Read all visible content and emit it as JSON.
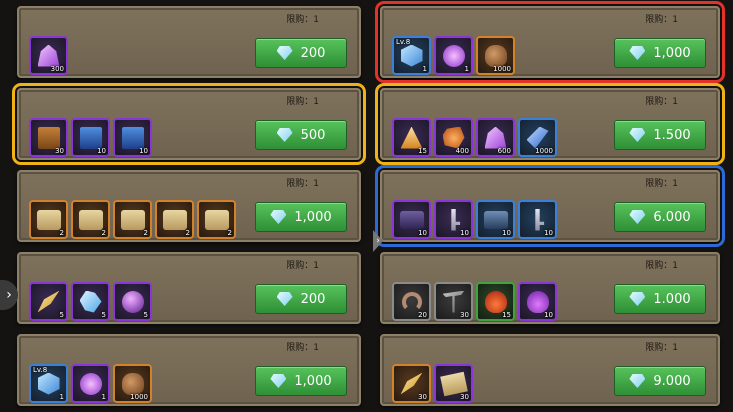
{
  "limit_label": "限购：1",
  "nav": {
    "left_arrow": "›",
    "mid_arrow": "›"
  },
  "left": [
    {
      "highlight": "",
      "price": "200",
      "items": [
        {
          "icon": "crystal-icon",
          "glyph": "g-crystal",
          "rarity": "purple",
          "qty": "300"
        }
      ]
    },
    {
      "highlight": "hl-yellow",
      "price": "500",
      "items": [
        {
          "icon": "book-icon",
          "glyph": "g-book",
          "rarity": "purple",
          "qty": "30"
        },
        {
          "icon": "blue-book-icon",
          "glyph": "g-book-blue",
          "rarity": "purple",
          "qty": "10"
        },
        {
          "icon": "blue-book-icon",
          "glyph": "g-book-blue",
          "rarity": "purple",
          "qty": "10"
        }
      ]
    },
    {
      "highlight": "",
      "price": "1,000",
      "items": [
        {
          "icon": "scroll-icon",
          "glyph": "g-scroll",
          "rarity": "orange",
          "qty": "2"
        },
        {
          "icon": "scroll-icon",
          "glyph": "g-scroll",
          "rarity": "orange",
          "qty": "2"
        },
        {
          "icon": "scroll-icon",
          "glyph": "g-scroll",
          "rarity": "orange",
          "qty": "2"
        },
        {
          "icon": "scroll-icon",
          "glyph": "g-scroll",
          "rarity": "orange",
          "qty": "2"
        },
        {
          "icon": "scroll-icon",
          "glyph": "g-scroll",
          "rarity": "orange",
          "qty": "2"
        }
      ]
    },
    {
      "highlight": "",
      "price": "200",
      "items": [
        {
          "icon": "feather-icon",
          "glyph": "g-feather",
          "rarity": "purple",
          "qty": "5"
        },
        {
          "icon": "ice-crystal-icon",
          "glyph": "g-ice",
          "rarity": "purple",
          "qty": "5"
        },
        {
          "icon": "orb-icon",
          "glyph": "g-orb",
          "rarity": "purple",
          "qty": "5"
        }
      ]
    },
    {
      "highlight": "",
      "price": "1,000",
      "items": [
        {
          "icon": "cube-icon",
          "glyph": "g-cube",
          "rarity": "blue",
          "qty": "1",
          "lv": "Lv.8"
        },
        {
          "icon": "disc-icon",
          "glyph": "g-disc",
          "rarity": "purple",
          "qty": "1"
        },
        {
          "icon": "pouch-icon",
          "glyph": "g-pouch",
          "rarity": "orange",
          "qty": "1000"
        }
      ]
    }
  ],
  "right": [
    {
      "highlight": "hl-red",
      "price": "1,000",
      "items": [
        {
          "icon": "cube-icon",
          "glyph": "g-cube",
          "rarity": "blue",
          "qty": "1",
          "lv": "Lv.8"
        },
        {
          "icon": "disc-icon",
          "glyph": "g-disc",
          "rarity": "purple",
          "qty": "1"
        },
        {
          "icon": "pouch-icon",
          "glyph": "g-pouch",
          "rarity": "orange",
          "qty": "1000"
        }
      ]
    },
    {
      "highlight": "hl-yellow",
      "price": "1.500",
      "items": [
        {
          "icon": "pyramid-icon",
          "glyph": "g-pyramid",
          "rarity": "purple",
          "qty": "15"
        },
        {
          "icon": "ore-icon",
          "glyph": "g-ore",
          "rarity": "purple",
          "qty": "400"
        },
        {
          "icon": "crystal-icon",
          "glyph": "g-crystal",
          "rarity": "purple",
          "qty": "600"
        },
        {
          "icon": "shard-icon",
          "glyph": "g-shard",
          "rarity": "blue",
          "qty": "1000"
        }
      ]
    },
    {
      "highlight": "hl-blue",
      "price": "6.000",
      "items": [
        {
          "icon": "chest-icon",
          "glyph": "g-chest",
          "rarity": "purple",
          "qty": "10"
        },
        {
          "icon": "key-icon",
          "glyph": "g-key",
          "rarity": "purple",
          "qty": "10"
        },
        {
          "icon": "blue-chest-icon",
          "glyph": "g-chest-blue",
          "rarity": "blue",
          "qty": "10"
        },
        {
          "icon": "key-icon",
          "glyph": "g-key",
          "rarity": "blue",
          "qty": "10"
        }
      ]
    },
    {
      "highlight": "",
      "price": "1.000",
      "items": [
        {
          "icon": "worm-icon",
          "glyph": "g-worm",
          "rarity": "grey",
          "qty": "20"
        },
        {
          "icon": "pickaxe-icon",
          "glyph": "g-pick",
          "rarity": "grey",
          "qty": "30"
        },
        {
          "icon": "potion-icon",
          "glyph": "g-potion",
          "rarity": "green",
          "qty": "15"
        },
        {
          "icon": "purple-potion-icon",
          "glyph": "g-potion-purple",
          "rarity": "purple",
          "qty": "10"
        }
      ]
    },
    {
      "highlight": "",
      "price": "9.000",
      "items": [
        {
          "icon": "feather-icon",
          "glyph": "g-feather",
          "rarity": "orange",
          "qty": "30"
        },
        {
          "icon": "map-icon",
          "glyph": "g-map",
          "rarity": "purple",
          "qty": "30"
        }
      ]
    }
  ]
}
